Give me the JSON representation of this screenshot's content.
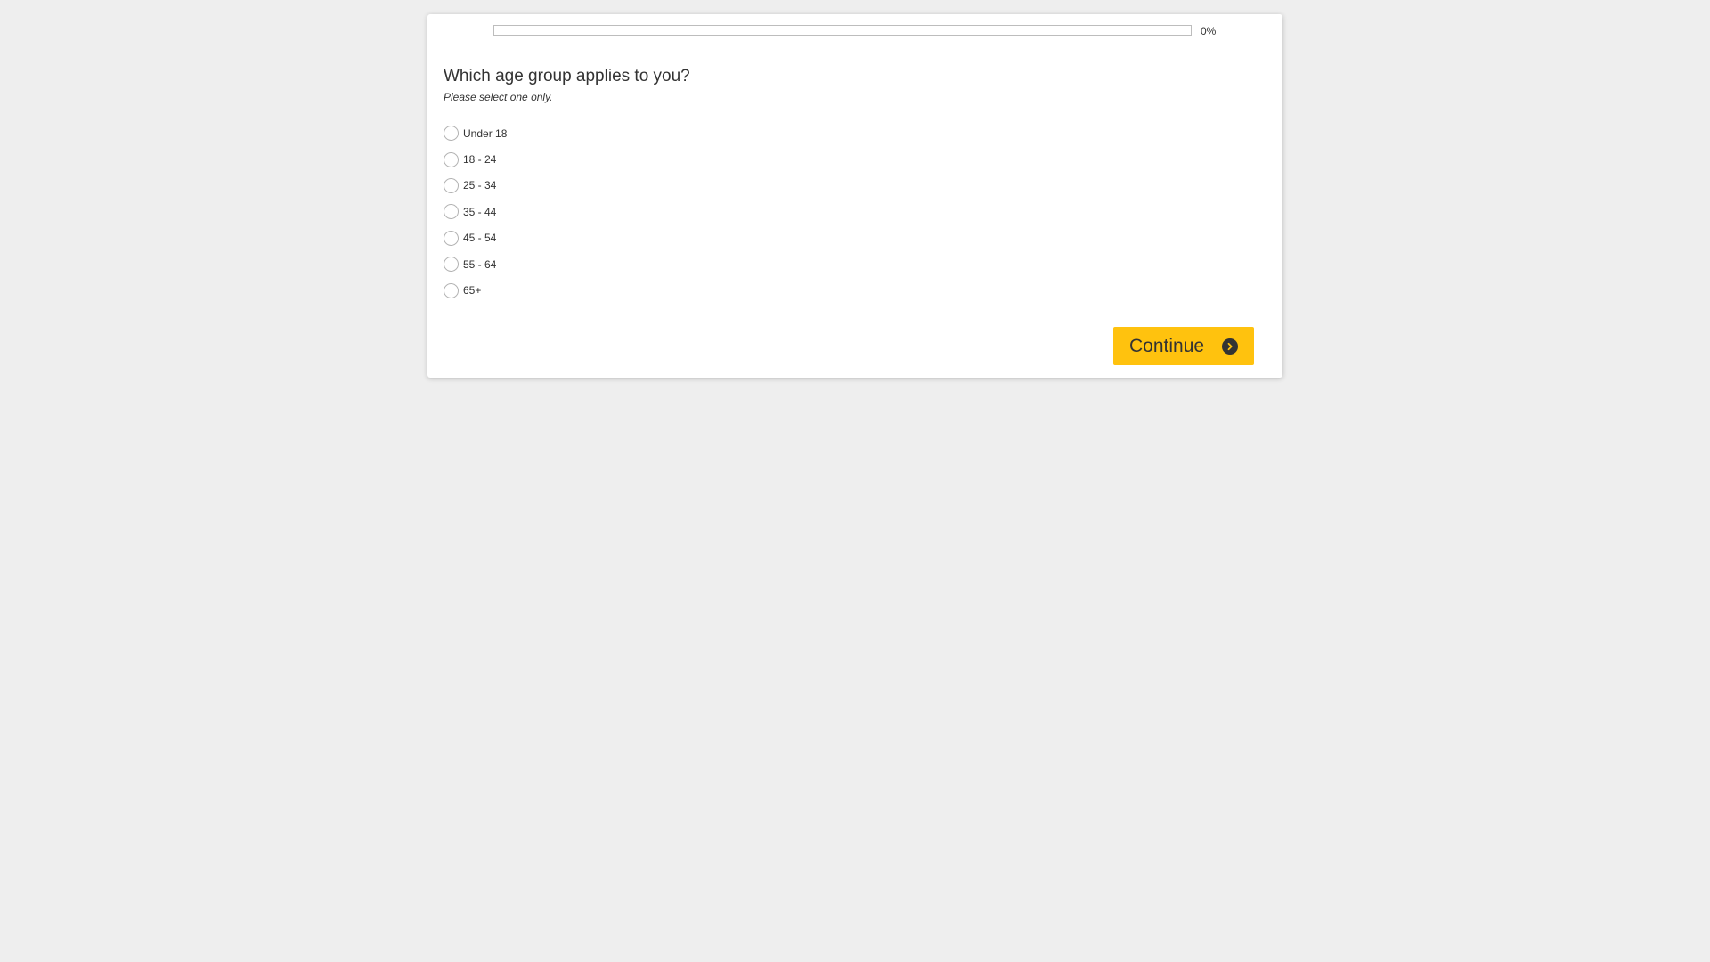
{
  "progress": {
    "value": 0,
    "label": "0%"
  },
  "question": {
    "title": "Which age group applies to you?",
    "instructions": "Please select one only.",
    "options": [
      {
        "label": "Under 18",
        "selected": false
      },
      {
        "label": "18 - 24",
        "selected": false
      },
      {
        "label": "25 - 34",
        "selected": false
      },
      {
        "label": "35 - 44",
        "selected": false
      },
      {
        "label": "45 - 54",
        "selected": false
      },
      {
        "label": "55 - 64",
        "selected": false
      },
      {
        "label": "65+",
        "selected": false
      }
    ]
  },
  "actions": {
    "continue_label": "Continue",
    "continue_icon": "chevron-right-circle-icon"
  },
  "colors": {
    "page_background": "#eeeeee",
    "card_background": "#ffffff",
    "accent": "#ffc20e",
    "text": "#333333"
  }
}
